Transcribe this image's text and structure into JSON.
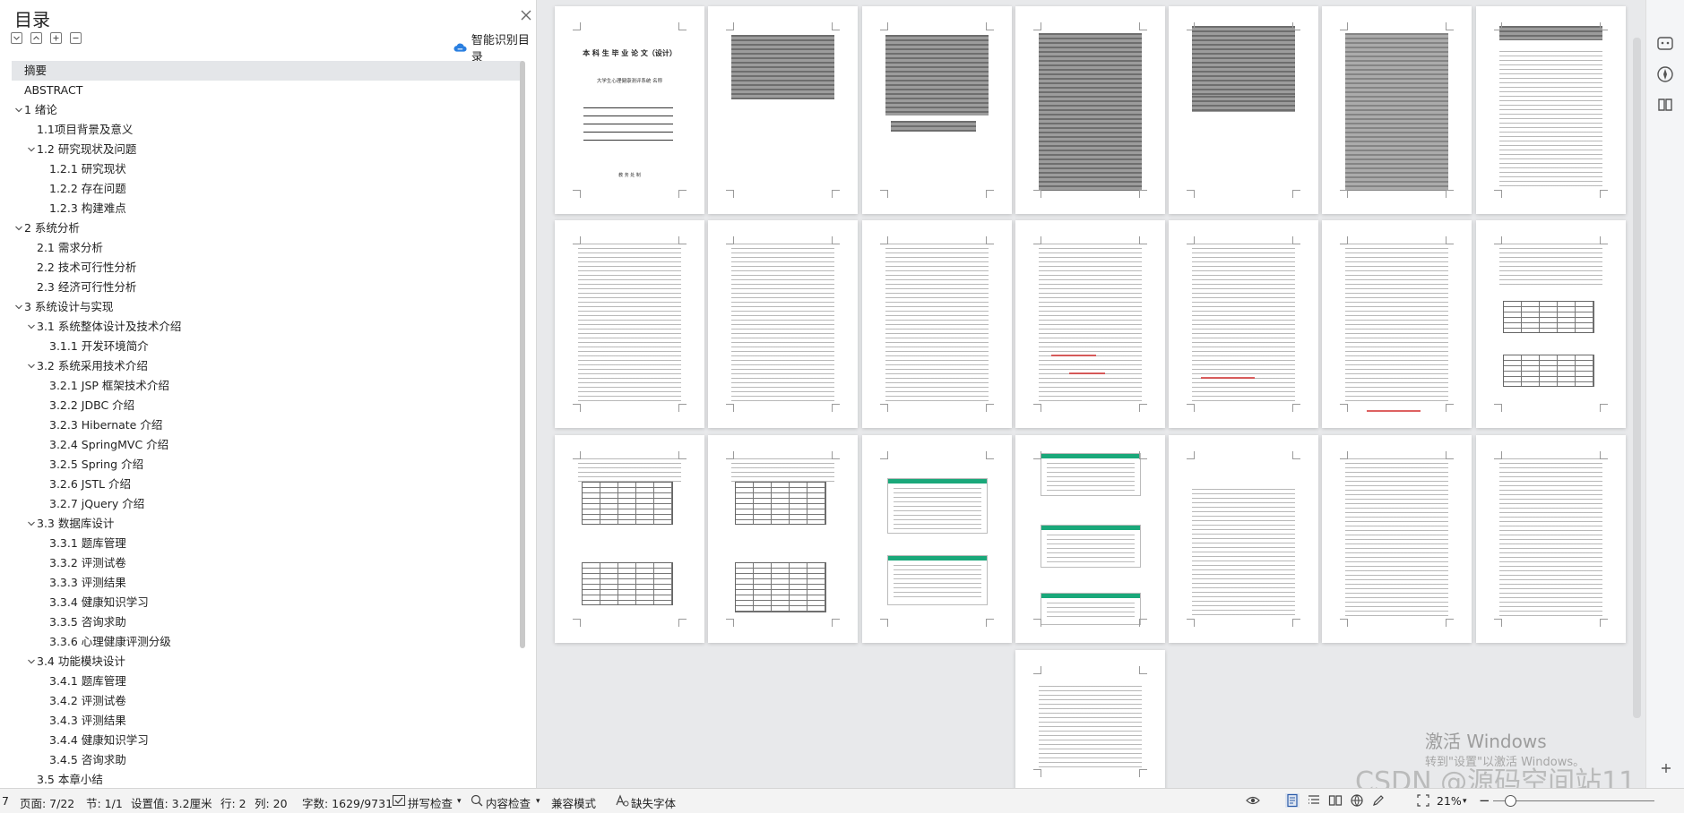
{
  "toc": {
    "title": "目录",
    "smart_toc_label": "智能识别目录",
    "items": [
      {
        "text": "摘要",
        "level": 1,
        "expandable": false,
        "selected": true
      },
      {
        "text": "ABSTRACT",
        "level": 1,
        "expandable": false
      },
      {
        "text": "1  绪论",
        "level": 1,
        "expandable": true
      },
      {
        "text": "1.1项目背景及意义",
        "level": 2,
        "expandable": false
      },
      {
        "text": "1.2  研究现状及问题",
        "level": 2,
        "expandable": true
      },
      {
        "text": "1.2.1  研究现状",
        "level": 3,
        "expandable": false
      },
      {
        "text": "1.2.2  存在问题",
        "level": 3,
        "expandable": false
      },
      {
        "text": "1.2.3  构建难点",
        "level": 3,
        "expandable": false
      },
      {
        "text": "2  系统分析",
        "level": 1,
        "expandable": true
      },
      {
        "text": "2.1  需求分析",
        "level": 2,
        "expandable": false
      },
      {
        "text": "2.2  技术可行性分析",
        "level": 2,
        "expandable": false
      },
      {
        "text": "2.3  经济可行性分析",
        "level": 2,
        "expandable": false
      },
      {
        "text": "3  系统设计与实现",
        "level": 1,
        "expandable": true
      },
      {
        "text": "3.1  系统整体设计及技术介绍",
        "level": 2,
        "expandable": true
      },
      {
        "text": "3.1.1  开发环境简介",
        "level": 3,
        "expandable": false
      },
      {
        "text": "3.2  系统采用技术介绍",
        "level": 2,
        "expandable": true
      },
      {
        "text": "3.2.1 JSP 框架技术介绍",
        "level": 3,
        "expandable": false
      },
      {
        "text": "3.2.2 JDBC 介绍",
        "level": 3,
        "expandable": false
      },
      {
        "text": "3.2.3 Hibernate 介绍",
        "level": 3,
        "expandable": false
      },
      {
        "text": "3.2.4 SpringMVC 介绍",
        "level": 3,
        "expandable": false
      },
      {
        "text": "3.2.5 Spring 介绍",
        "level": 3,
        "expandable": false
      },
      {
        "text": "3.2.6 JSTL 介绍",
        "level": 3,
        "expandable": false
      },
      {
        "text": "3.2.7 jQuery 介绍",
        "level": 3,
        "expandable": false
      },
      {
        "text": "3.3  数据库设计",
        "level": 2,
        "expandable": true
      },
      {
        "text": "3.3.1  题库管理",
        "level": 3,
        "expandable": false
      },
      {
        "text": "3.3.2  评测试卷",
        "level": 3,
        "expandable": false
      },
      {
        "text": "3.3.3  评测结果",
        "level": 3,
        "expandable": false
      },
      {
        "text": "3.3.4  健康知识学习",
        "level": 3,
        "expandable": false
      },
      {
        "text": "3.3.5  咨询求助",
        "level": 3,
        "expandable": false
      },
      {
        "text": "3.3.6  心理健康评测分级",
        "level": 3,
        "expandable": false
      },
      {
        "text": "3.4  功能模块设计",
        "level": 2,
        "expandable": true
      },
      {
        "text": "3.4.1  题库管理",
        "level": 3,
        "expandable": false
      },
      {
        "text": "3.4.2  评测试卷",
        "level": 3,
        "expandable": false
      },
      {
        "text": "3.4.3  评测结果",
        "level": 3,
        "expandable": false
      },
      {
        "text": "3.4.4  健康知识学习",
        "level": 3,
        "expandable": false
      },
      {
        "text": "3.4.5  咨询求助",
        "level": 3,
        "expandable": false
      },
      {
        "text": "3.5  本章小结",
        "level": 2,
        "expandable": false
      }
    ]
  },
  "document": {
    "cover_title": "本 科 生 毕 业 论 文（设计）",
    "cover_subtitle": "大学生心理健康测评系统 名称",
    "cover_footer": "教 务 处 制",
    "page_count_visible": 22
  },
  "status_bar": {
    "page_fragment": "7",
    "page": "页面: 7/22",
    "section": "节: 1/1",
    "setting": "设置值: 3.2厘米",
    "row": "行: 2",
    "col": "列: 20",
    "wordcount": "字数: 1629/9731",
    "spellcheck": "拼写检查",
    "content_check": "内容检查",
    "compat": "兼容模式",
    "missing_font": "缺失字体",
    "zoom": "21%"
  },
  "watermarks": {
    "activate_windows": "激活 Windows",
    "activate_hint": "转到\"设置\"以激活 Windows。",
    "csdn": "CSDN @源码空间站11"
  },
  "colors": {
    "accent_green": "#1aa87a",
    "brand_blue": "#2a7fe0",
    "selected_row": "#e4e6e9"
  }
}
